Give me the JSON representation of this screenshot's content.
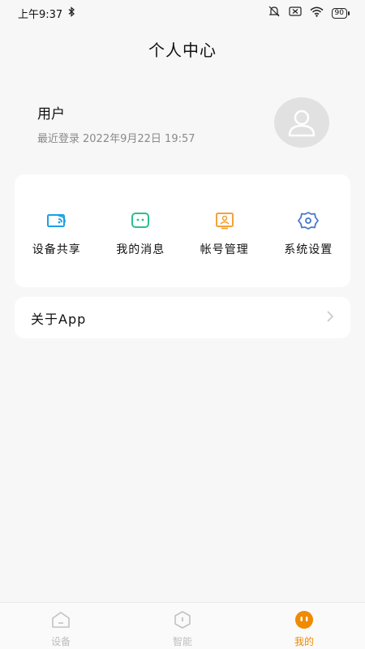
{
  "status_bar": {
    "time": "上午9:37",
    "battery": "90"
  },
  "page": {
    "title": "个人中心"
  },
  "profile": {
    "name": "用户",
    "login_label": "最近登录",
    "login_time": "2022年9月22日 19:57"
  },
  "menu": [
    {
      "label": "设备共享",
      "icon": "screen-share-icon",
      "color": "#1aa0e6"
    },
    {
      "label": "我的消息",
      "icon": "message-icon",
      "color": "#2bbf8a"
    },
    {
      "label": "帐号管理",
      "icon": "account-card-icon",
      "color": "#f2a33a"
    },
    {
      "label": "系统设置",
      "icon": "gear-icon",
      "color": "#4a76c9"
    }
  ],
  "about": {
    "label": "关于App"
  },
  "tabs": [
    {
      "label": "设备",
      "icon": "home-icon",
      "active": false
    },
    {
      "label": "智能",
      "icon": "smart-icon",
      "active": false
    },
    {
      "label": "我的",
      "icon": "mine-icon",
      "active": true
    }
  ],
  "colors": {
    "accent": "#f08a00",
    "background": "#f7f7f7"
  }
}
